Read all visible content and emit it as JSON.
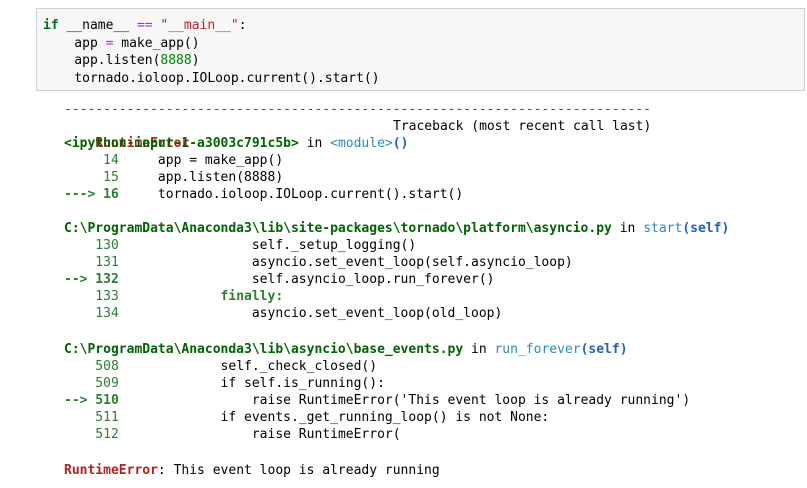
{
  "input_cell": {
    "lines": [
      [
        "if",
        " __name__ ",
        "==",
        " ",
        "\"__main__\"",
        ":"
      ],
      [
        "    app ",
        "=",
        " make_app()"
      ],
      [
        "    app.listen(",
        "8888",
        ")"
      ],
      [
        "    tornado.ioloop.IOLoop.current().start()"
      ]
    ]
  },
  "output": {
    "dash_line": "---------------------------------------------------------------------------",
    "error_name": "RuntimeError",
    "traceback_header": "Traceback (most recent call last)",
    "frame1": {
      "file": "<ipython-input-1-a3003c791c5b>",
      "in": " in ",
      "func": "<module>",
      "parens": "()",
      "lines": [
        {
          "num": "     14",
          "code": "     app = make_app()"
        },
        {
          "num": "     15",
          "code": "     app.listen(8888)"
        },
        {
          "num": "---> 16",
          "code": "     tornado.ioloop.IOLoop.current().start()"
        }
      ]
    },
    "frame2": {
      "file": "C:\\ProgramData\\Anaconda3\\lib\\site-packages\\tornado\\platform\\asyncio.py",
      "in": " in ",
      "func": "start",
      "args": "(self)",
      "lines": [
        {
          "num": "    130",
          "code": "                 self._setup_logging()"
        },
        {
          "num": "    131",
          "code": "                 asyncio.set_event_loop(self.asyncio_loop)"
        },
        {
          "num": "--> 132",
          "code": "                 self.asyncio_loop.run_forever()"
        },
        {
          "num": "    133",
          "code": "             finally:"
        },
        {
          "num": "    134",
          "code": "                 asyncio.set_event_loop(old_loop)"
        }
      ]
    },
    "frame3": {
      "file": "C:\\ProgramData\\Anaconda3\\lib\\asyncio\\base_events.py",
      "in": " in ",
      "func": "run_forever",
      "args": "(self)",
      "lines": [
        {
          "num": "    508",
          "code": "             self._check_closed()"
        },
        {
          "num": "    509",
          "code": "             if self.is_running():"
        },
        {
          "num": "--> 510",
          "code": "                 raise RuntimeError('This event loop is already running')"
        },
        {
          "num": "    511",
          "code": "             if events._get_running_loop() is not None:"
        },
        {
          "num": "    512",
          "code": "                 raise RuntimeError("
        }
      ]
    },
    "final_error": {
      "name": "RuntimeError",
      "message": ": This event loop is already running"
    }
  }
}
